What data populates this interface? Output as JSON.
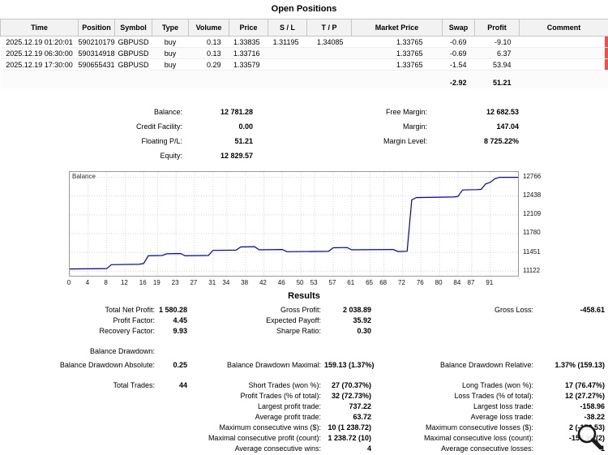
{
  "title": "Open Positions",
  "colors": {
    "line": "#0000cc",
    "row_marker": "#ff4a4a",
    "header_bg": "#f2f2f2",
    "border": "#c6c6c6"
  },
  "positions_table": {
    "columns": [
      "Time",
      "Position",
      "Symbol",
      "Type",
      "Volume",
      "Price",
      "S / L",
      "T / P",
      "Market Price",
      "Swap",
      "Profit",
      "Comment"
    ],
    "rows": [
      [
        "2025.12.19 01:20:01",
        "590210179",
        "GBPUSD",
        "buy",
        "0.13",
        "1.33835",
        "1.31195",
        "1.34085",
        "1.33765",
        "-0.69",
        "-9.10",
        ""
      ],
      [
        "2025.12.19 06:30:00",
        "590314918",
        "GBPUSD",
        "buy",
        "0.13",
        "1.33716",
        "",
        "",
        "1.33765",
        "-0.69",
        "6.37",
        ""
      ],
      [
        "2025.12.19 17:30:00",
        "590655431",
        "GBPUSD",
        "buy",
        "0.29",
        "1.33579",
        "",
        "",
        "1.33765",
        "-1.54",
        "53.94",
        ""
      ]
    ],
    "totals": {
      "swap": "-2.92",
      "profit": "51.21"
    }
  },
  "account_summary": {
    "rows": [
      [
        "Balance:",
        "12 781.28",
        "Free Margin:",
        "12 682.53"
      ],
      [
        "Credit Facility:",
        "0.00",
        "Margin:",
        "147.04"
      ],
      [
        "Floating P/L:",
        "51.21",
        "Margin Level:",
        "8 725.22%"
      ],
      [
        "Equity:",
        "12 829.57",
        "",
        ""
      ]
    ]
  },
  "chart_data": {
    "type": "line",
    "series_label": "Balance",
    "x": [
      0,
      8,
      9,
      15,
      16,
      17,
      20,
      21,
      24,
      25,
      30,
      31,
      36,
      37,
      40,
      41,
      46,
      47,
      56,
      57,
      60,
      61,
      70,
      71,
      73,
      74,
      75,
      83,
      84,
      85,
      88,
      89,
      90,
      91,
      92,
      93,
      97
    ],
    "y": [
      11160,
      11165,
      11235,
      11240,
      11255,
      11390,
      11395,
      11425,
      11430,
      11390,
      11395,
      11485,
      11490,
      11545,
      11550,
      11495,
      11500,
      11462,
      11468,
      11530,
      11535,
      11495,
      11500,
      11465,
      11470,
      12370,
      12410,
      12420,
      12430,
      12545,
      12550,
      12555,
      12650,
      12680,
      12740,
      12766,
      12766
    ],
    "x_ticks": [
      0,
      4,
      8,
      12,
      16,
      19,
      23,
      27,
      31,
      34,
      38,
      42,
      46,
      50,
      53,
      57,
      61,
      65,
      68,
      72,
      76,
      80,
      84,
      87,
      91
    ],
    "y_ticks": [
      11122,
      11451,
      11780,
      12109,
      12438,
      12766
    ],
    "xlim": [
      0,
      97
    ],
    "ylim": [
      11040,
      12860
    ],
    "grid": true,
    "line_color": "#0000cc"
  },
  "results": {
    "title": "Results",
    "rows": [
      [
        "Total Net Profit:",
        "1 580.28",
        "Gross Profit:",
        "2 038.89",
        "Gross Loss:",
        "-458.61"
      ],
      [
        "Profit Factor:",
        "4.45",
        "Expected Payoff:",
        "35.92",
        "",
        ""
      ],
      [
        "Recovery Factor:",
        "9.93",
        "Sharpe Ratio:",
        "0.30",
        "",
        ""
      ],
      [
        "Balance Drawdown:",
        "",
        "",
        "",
        "",
        ""
      ],
      [
        "Balance Drawdown Absolute:",
        "0.25",
        "Balance Drawdown Maximal:",
        "159.13 (1.37%)",
        "Balance Drawdown Relative:",
        "1.37% (159.13)"
      ],
      [
        "Total Trades:",
        "44",
        "Short Trades (won %):",
        "27 (70.37%)",
        "Long Trades (won %):",
        "17 (76.47%)"
      ],
      [
        "",
        "",
        "Profit Trades (% of total):",
        "32 (72.73%)",
        "Loss Trades (% of total):",
        "12 (27.27%)"
      ],
      [
        "",
        "",
        "Largest profit trade:",
        "737.22",
        "Largest loss trade:",
        "-158.96"
      ],
      [
        "",
        "",
        "Average profit trade:",
        "63.72",
        "Average loss trade:",
        "-38.22"
      ],
      [
        "",
        "",
        "Maximum consecutive wins ($):",
        "10 (1 238.72)",
        "Maximum consecutive losses ($):",
        "2 (-153.53)"
      ],
      [
        "",
        "",
        "Maximal consecutive profit (count):",
        "1 238.72 (10)",
        "Maximal consecutive loss (count):",
        "-158.96 (2)"
      ],
      [
        "",
        "",
        "Average consecutive wins:",
        "4",
        "Average consecutive losses:",
        "1"
      ]
    ]
  }
}
